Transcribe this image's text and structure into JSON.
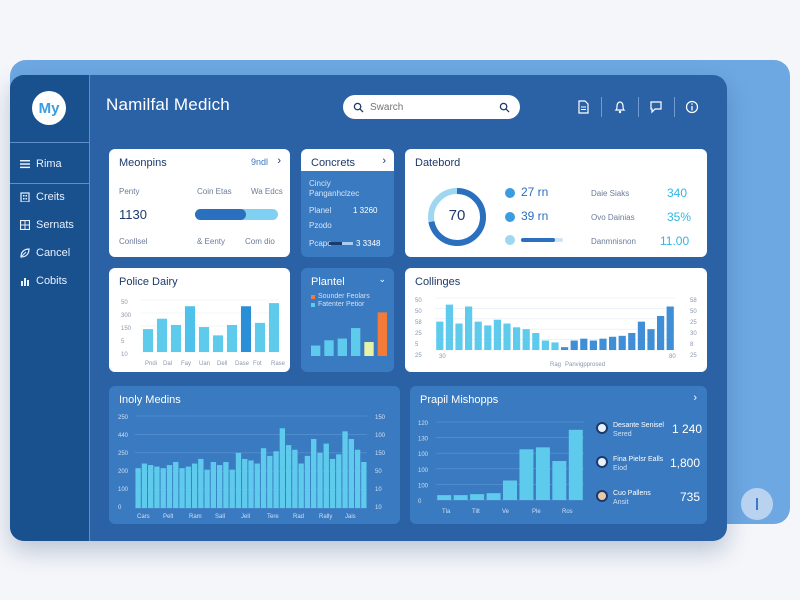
{
  "app": {
    "title": "Namilfal Medich",
    "logo_text": "My"
  },
  "search": {
    "placeholder": "Swarch"
  },
  "sidebar": {
    "items": [
      {
        "label": "Rima",
        "icon": "menu-icon"
      },
      {
        "label": "Creits",
        "icon": "building-icon"
      },
      {
        "label": "Sernats",
        "icon": "grid-icon"
      },
      {
        "label": "Cancel",
        "icon": "leaf-icon"
      },
      {
        "label": "Cobits",
        "icon": "chart-icon"
      }
    ]
  },
  "top_icons": [
    "document-icon",
    "bell-icon",
    "chat-icon",
    "info-icon"
  ],
  "cards": {
    "meonpins": {
      "title": "Meonpins",
      "right": "9ndl",
      "lbl_1": "Penty",
      "lbl_2": "Coin Etas",
      "lbl_3": "Wa Edcs",
      "value": "1130",
      "progress": 0.62,
      "foot_1": "Conllsel",
      "foot_2": "& Eenty",
      "foot_3": "Com dio"
    },
    "concrets": {
      "title": "Concrets",
      "line_1": "Cinciy",
      "line_2": "Panganhclzec",
      "row_1_label": "Planel",
      "row_1_value": "1 3260",
      "row_2_label": "Pzodo",
      "row_3_label": "Pcapo",
      "row_3_value": "3 3348",
      "progress": 0.55
    },
    "dateboard": {
      "title": "Datebord",
      "gauge_value": "70",
      "gauge_fraction": 0.72,
      "stat_1": "27 rn",
      "stat_2": "39 rn",
      "r1_label": "Daie Siaks",
      "r1_value": "340",
      "r2_label": "Ovo Dainias",
      "r2_value": "35%",
      "r3_label": "Danmnisnon",
      "r3_value": "11.00",
      "progress": 0.8
    },
    "police": {
      "title": "Police Dairy"
    },
    "plantel": {
      "title": "Plantel",
      "legend_1": "Sounder Feolars",
      "legend_2": "Fatenter Petior"
    },
    "collings": {
      "title": "Collinges"
    },
    "holy": {
      "title": "Inoly Medins"
    },
    "pranil": {
      "title": "Prapil Mishopps",
      "people": [
        {
          "name": "Desante Senisel",
          "role": "Sered",
          "value": "1 240"
        },
        {
          "name": "Fina Pielsr Ealls",
          "role": "Eiod",
          "value": "1,800"
        },
        {
          "name": "Cuo Pallens",
          "role": "Ansit",
          "value": "735"
        }
      ]
    }
  },
  "chart_data": [
    {
      "type": "bar",
      "title": "Police Dairy",
      "categories": [
        "Pndi",
        "Dal",
        "Fay",
        "Uan",
        "Dell",
        "Dase",
        "Fot",
        "Rase"
      ],
      "values": [
        22,
        32,
        26,
        44,
        24,
        16,
        26,
        44,
        28,
        47
      ],
      "colors": [
        "#5ecbed",
        "#5ecbed",
        "#5ecbed",
        "#4fc2ec",
        "#5ecbed",
        "#5ecbed",
        "#5ecbed",
        "#2b8fd8",
        "#5ecbed",
        "#5ecbed"
      ],
      "yticks": [
        "50",
        "300",
        "150",
        "5",
        "10"
      ],
      "ylim": [
        0,
        50
      ]
    },
    {
      "type": "bar",
      "title": "Plantel",
      "values": [
        12,
        18,
        20,
        32,
        16,
        50
      ],
      "colors": [
        "#5ecbed",
        "#5ecbed",
        "#5ecbed",
        "#5ecbed",
        "#e8f1a8",
        "#f27b3a"
      ],
      "ylim": [
        0,
        55
      ]
    },
    {
      "type": "bar",
      "title": "Collinges",
      "values": [
        30,
        48,
        28,
        46,
        30,
        26,
        32,
        28,
        24,
        22,
        18,
        10,
        8,
        3,
        10,
        12,
        10,
        12,
        14,
        15,
        18,
        30,
        22,
        36,
        46
      ],
      "ylim": [
        0,
        55
      ],
      "yticks_left": [
        "50",
        "50",
        "58",
        "25",
        "5",
        "25"
      ],
      "yticks_right": [
        "58",
        "50",
        "25",
        "30",
        "8",
        "25"
      ],
      "xlabel_1": "Rag",
      "xlabel_2": "Panvigpprosed",
      "xticks": [
        "30",
        "80"
      ]
    },
    {
      "type": "bar",
      "title": "Inoly Medins",
      "categories": [
        "Cars",
        "Pelt",
        "Ram",
        "Sall",
        "Jell",
        "Tere",
        "Rad",
        "Rally",
        "Jais"
      ],
      "values": [
        52,
        58,
        56,
        54,
        52,
        56,
        60,
        52,
        54,
        58,
        64,
        50,
        60,
        56,
        60,
        50,
        72,
        64,
        62,
        58,
        78,
        68,
        74,
        104,
        82,
        76,
        58,
        68,
        90,
        72,
        84,
        64,
        70,
        100,
        90,
        76,
        60
      ],
      "ylim": [
        0,
        120
      ],
      "yticks_left": [
        "250",
        "440",
        "250",
        "200",
        "100",
        "0"
      ],
      "yticks_right": [
        "150",
        "100",
        "150",
        "50",
        "10",
        "10"
      ]
    },
    {
      "type": "bar",
      "title": "Prapil Mishopps",
      "categories": [
        "Tla",
        "Tilt",
        "Ve",
        "Ple",
        "Ros"
      ],
      "values": [
        5,
        5,
        6,
        7,
        20,
        52,
        54,
        40,
        72
      ],
      "ylim": [
        0,
        80
      ],
      "yticks": [
        "120",
        "130",
        "100",
        "100",
        "100",
        "0"
      ]
    }
  ]
}
